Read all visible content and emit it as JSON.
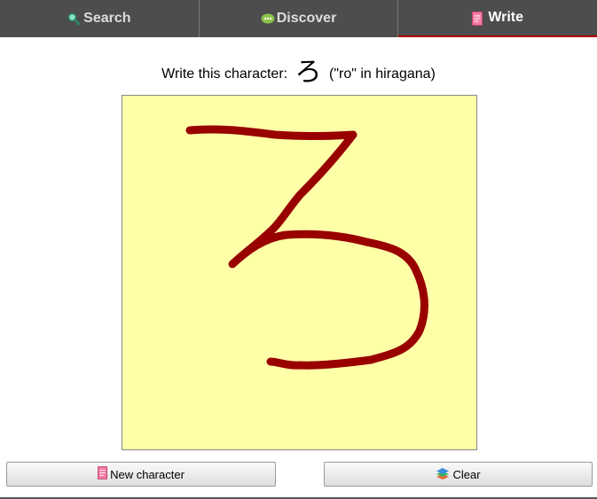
{
  "tabs": [
    {
      "label": "Search",
      "icon": "magnifier-icon",
      "active": false
    },
    {
      "label": "Discover",
      "icon": "speech-bubble-icon",
      "active": false
    },
    {
      "label": "Write",
      "icon": "notepad-icon",
      "active": true
    }
  ],
  "prompt": {
    "prefix": "Write this character:",
    "character": "ろ",
    "suffix": "(\"ro\" in hiragana)"
  },
  "canvas": {
    "background": "#ffffa8",
    "stroke_color": "#990000"
  },
  "buttons": {
    "new_character": "New character",
    "clear": "Clear"
  },
  "colors": {
    "tabbar": "#4d4d4d",
    "active_tab_underline": "#b00000"
  }
}
